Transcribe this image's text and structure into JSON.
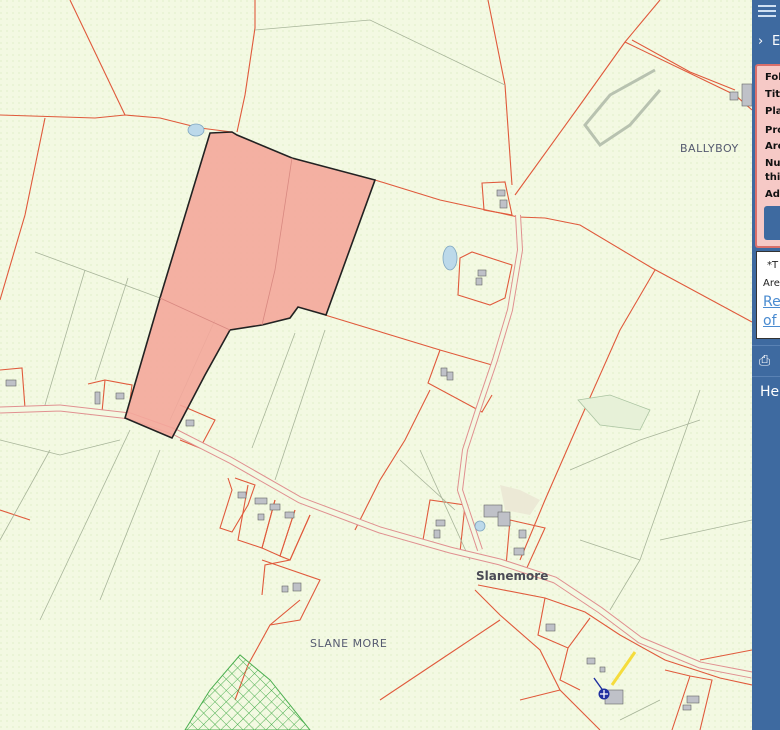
{
  "map": {
    "labels": {
      "ballyboy": "BALLYBOY",
      "slanemore_town": "Slanemore",
      "slane_more": "SLANE MORE"
    },
    "colors": {
      "background": "#f3f9e2",
      "boundary": "#e05a3c",
      "selected_parcel_fill": "#f4a79b",
      "selected_parcel_stroke": "#222222",
      "road": "#e8a0a0",
      "forest": "#4caf50",
      "yellow_line": "#f5dc3c",
      "marker": "#1f2fa0"
    }
  },
  "panel": {
    "expand_label": "E",
    "info_rows": [
      "Fol",
      "Titl",
      "Pla",
      "Pro",
      "Are",
      "Nu",
      "this",
      "Ad"
    ],
    "note_line1": "*T",
    "note_line2": "Are",
    "link_line1": "Re",
    "link_line2": "of t",
    "help_label": "Hel",
    "colors": {
      "panel_bg": "#3e6aa0",
      "info_bg": "#f6c9c6",
      "info_border": "#d96f6a"
    }
  }
}
